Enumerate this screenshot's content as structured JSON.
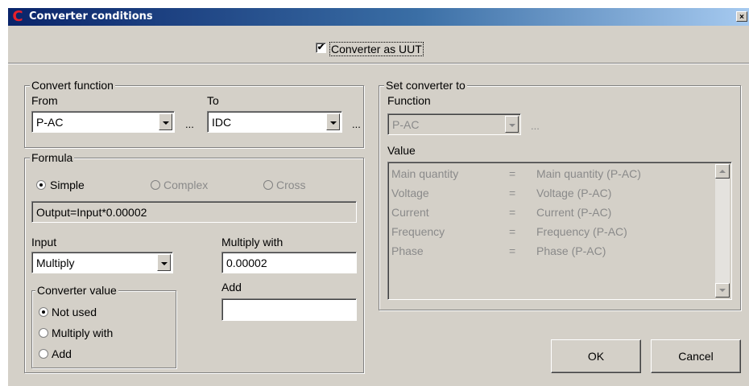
{
  "window": {
    "title": "Converter conditions",
    "close_glyph": "×",
    "logo_glyph": "C"
  },
  "uut_checkbox": {
    "label": "Converter as UUT",
    "checked": true,
    "glyph": "✔"
  },
  "convert_function": {
    "title": "Convert function",
    "from_label": "From",
    "from_value": "P-AC",
    "to_label": "To",
    "to_value": "IDC",
    "dots": "..."
  },
  "formula": {
    "title": "Formula",
    "options": [
      {
        "label": "Simple",
        "selected": true,
        "enabled": true
      },
      {
        "label": "Complex",
        "selected": false,
        "enabled": false
      },
      {
        "label": "Cross",
        "selected": false,
        "enabled": false
      }
    ],
    "expression": "Output=Input*0.00002",
    "input_label": "Input",
    "input_value": "Multiply",
    "multiply_label": "Multiply with",
    "multiply_value": "0.00002",
    "add_label": "Add",
    "add_value": ""
  },
  "converter_value": {
    "title": "Converter value",
    "options": [
      {
        "label": "Not used",
        "selected": true
      },
      {
        "label": "Multiply with",
        "selected": false
      },
      {
        "label": "Add",
        "selected": false
      }
    ]
  },
  "set_converter": {
    "title": "Set converter to",
    "function_label": "Function",
    "function_value": "P-AC",
    "dots": "...",
    "value_label": "Value",
    "rows": [
      {
        "name": "Main quantity",
        "eq": "=",
        "value": "Main quantity (P-AC)"
      },
      {
        "name": "Voltage",
        "eq": "=",
        "value": "Voltage (P-AC)"
      },
      {
        "name": "Current",
        "eq": "=",
        "value": "Current (P-AC)"
      },
      {
        "name": "Frequency",
        "eq": "=",
        "value": "Frequency (P-AC)"
      },
      {
        "name": "Phase",
        "eq": "=",
        "value": "Phase (P-AC)"
      }
    ]
  },
  "buttons": {
    "ok": "OK",
    "cancel": "Cancel"
  },
  "colors": {
    "face": "#d4d0c8",
    "title_start": "#0a246a",
    "title_end": "#a6caf0",
    "logo": "#e8202a",
    "disabled_text": "#8a8a8a"
  }
}
